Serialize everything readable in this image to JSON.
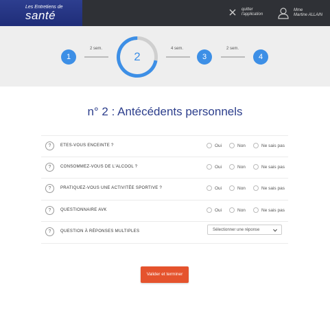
{
  "header": {
    "logo_small": "Les Entretiens de",
    "logo_big": "santé",
    "quit_line1": "quitter",
    "quit_line2": "l'application",
    "user_line1": "Mme",
    "user_line2": "Martine ALLAIN"
  },
  "stepper": {
    "steps": [
      "1",
      "2",
      "3",
      "4"
    ],
    "intervals": [
      "2 sem.",
      "4 sem.",
      "2 sem."
    ],
    "current_step": 2,
    "current_progress": 0.72
  },
  "section_title": "n° 2 : Antécédents personnels",
  "options": {
    "yes": "Oui",
    "no": "Non",
    "unknown": "Ne sais pas"
  },
  "questions": [
    "ETES-VOUS ENCEINTE ?",
    "CONSOMMEZ-VOUS DE L'ALCOOL ?",
    "PRATIQUEZ-VOUS UNE ACTIVITÉE SPORTIVE ?",
    "QUESTIONNAIRE AVK",
    "QUESTION À RÉPONSES MULTIPLES"
  ],
  "help_glyph": "?",
  "select_placeholder": "Sélectionner une réponse",
  "submit_label": "Valider et terminer",
  "colors": {
    "brand": "#2d3e8f",
    "accent": "#3d8fe6",
    "button": "#e5532d"
  }
}
